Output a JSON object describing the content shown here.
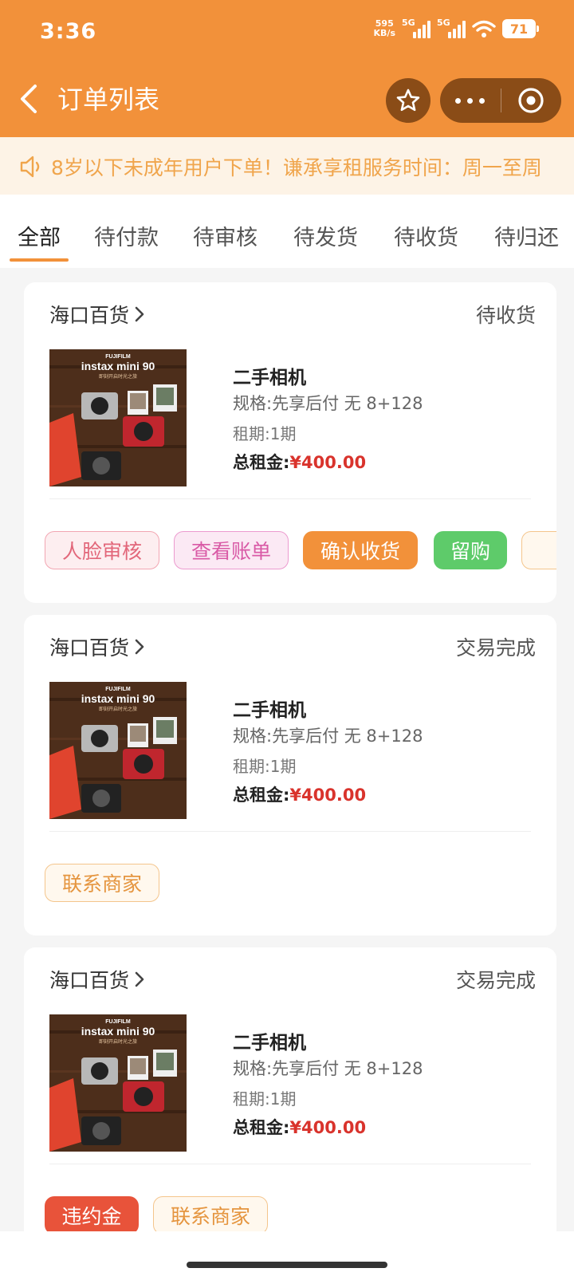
{
  "status_bar": {
    "time": "3:36",
    "net_speed_value": "595",
    "net_speed_unit": "KB/s",
    "sim1": "5G",
    "sim2": "5G",
    "battery": "71"
  },
  "nav": {
    "title": "订单列表"
  },
  "notice": {
    "text": "8岁以下未成年用户下单！谦承享租服务时间：周一至周"
  },
  "tabs": [
    {
      "label": "全部",
      "active": true
    },
    {
      "label": "待付款"
    },
    {
      "label": "待审核"
    },
    {
      "label": "待发货"
    },
    {
      "label": "待收货"
    },
    {
      "label": "待归还"
    }
  ],
  "orders": [
    {
      "shop": "海口百货",
      "status": "待收货",
      "product_name": "二手相机",
      "spec": "规格:先享后付 无 8+128",
      "term": "租期:1期",
      "total_label": "总租金:",
      "currency": "¥",
      "total": "400.00",
      "thumb_brand": "FUJIFILM",
      "thumb_model": "instax mini 90",
      "thumb_sub": "即刻开启时光之旅",
      "actions": [
        "人脸审核",
        "查看账单",
        "确认收货",
        "留购"
      ]
    },
    {
      "shop": "海口百货",
      "status": "交易完成",
      "product_name": "二手相机",
      "spec": "规格:先享后付 无 8+128",
      "term": "租期:1期",
      "total_label": "总租金:",
      "currency": "¥",
      "total": "400.00",
      "thumb_brand": "FUJIFILM",
      "thumb_model": "instax mini 90",
      "thumb_sub": "即刻开启时光之旅",
      "actions": [
        "联系商家"
      ]
    },
    {
      "shop": "海口百货",
      "status": "交易完成",
      "product_name": "二手相机",
      "spec": "规格:先享后付 无 8+128",
      "term": "租期:1期",
      "total_label": "总租金:",
      "currency": "¥",
      "total": "400.00",
      "thumb_brand": "FUJIFILM",
      "thumb_model": "instax mini 90",
      "thumb_sub": "即刻开启时光之旅",
      "actions": [
        "违约金",
        "联系商家"
      ]
    }
  ],
  "colors": {
    "brand": "#f2913a",
    "price": "#d9332c",
    "notice_text": "#f0a54c"
  }
}
